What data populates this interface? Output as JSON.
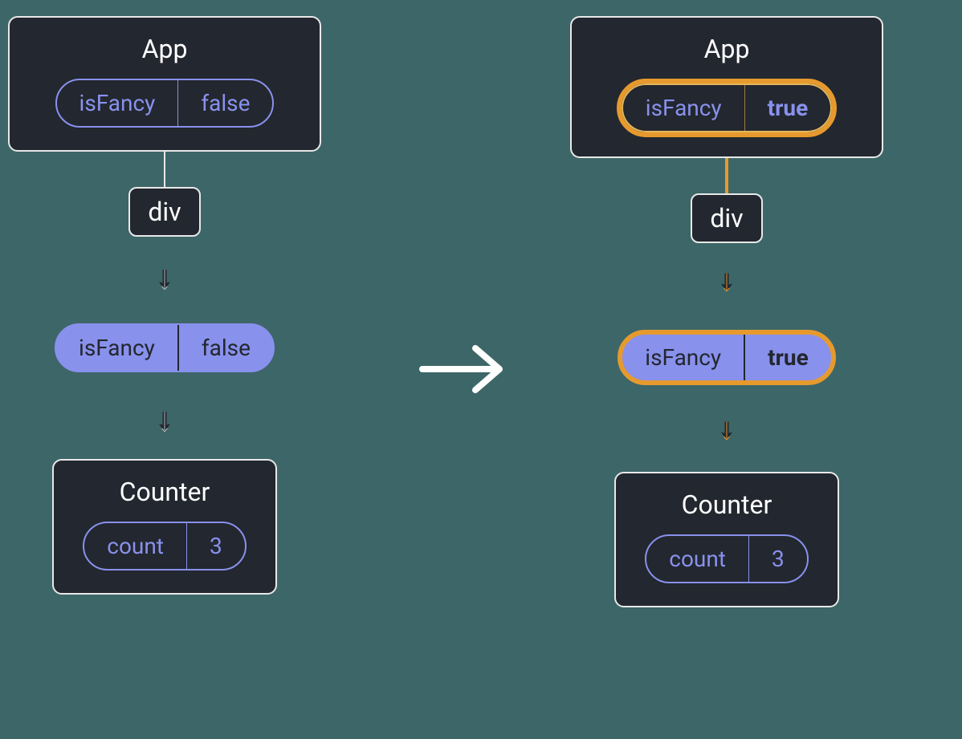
{
  "left": {
    "app": {
      "title": "App",
      "state": {
        "key": "isFancy",
        "value": "false"
      }
    },
    "elem": "div",
    "prop": {
      "key": "isFancy",
      "value": "false"
    },
    "counter": {
      "title": "Counter",
      "state": {
        "key": "count",
        "value": "3"
      }
    }
  },
  "right": {
    "app": {
      "title": "App",
      "state": {
        "key": "isFancy",
        "value": "true"
      },
      "highlighted": true
    },
    "elem": "div",
    "prop": {
      "key": "isFancy",
      "value": "true",
      "highlighted": true
    },
    "counter": {
      "title": "Counter",
      "state": {
        "key": "count",
        "value": "3"
      }
    }
  },
  "colors": {
    "bg": "#3d6668",
    "nodeBg": "#23272f",
    "border": "#e8e8e8",
    "accent": "#8891ec",
    "highlight": "#e69a2e"
  }
}
